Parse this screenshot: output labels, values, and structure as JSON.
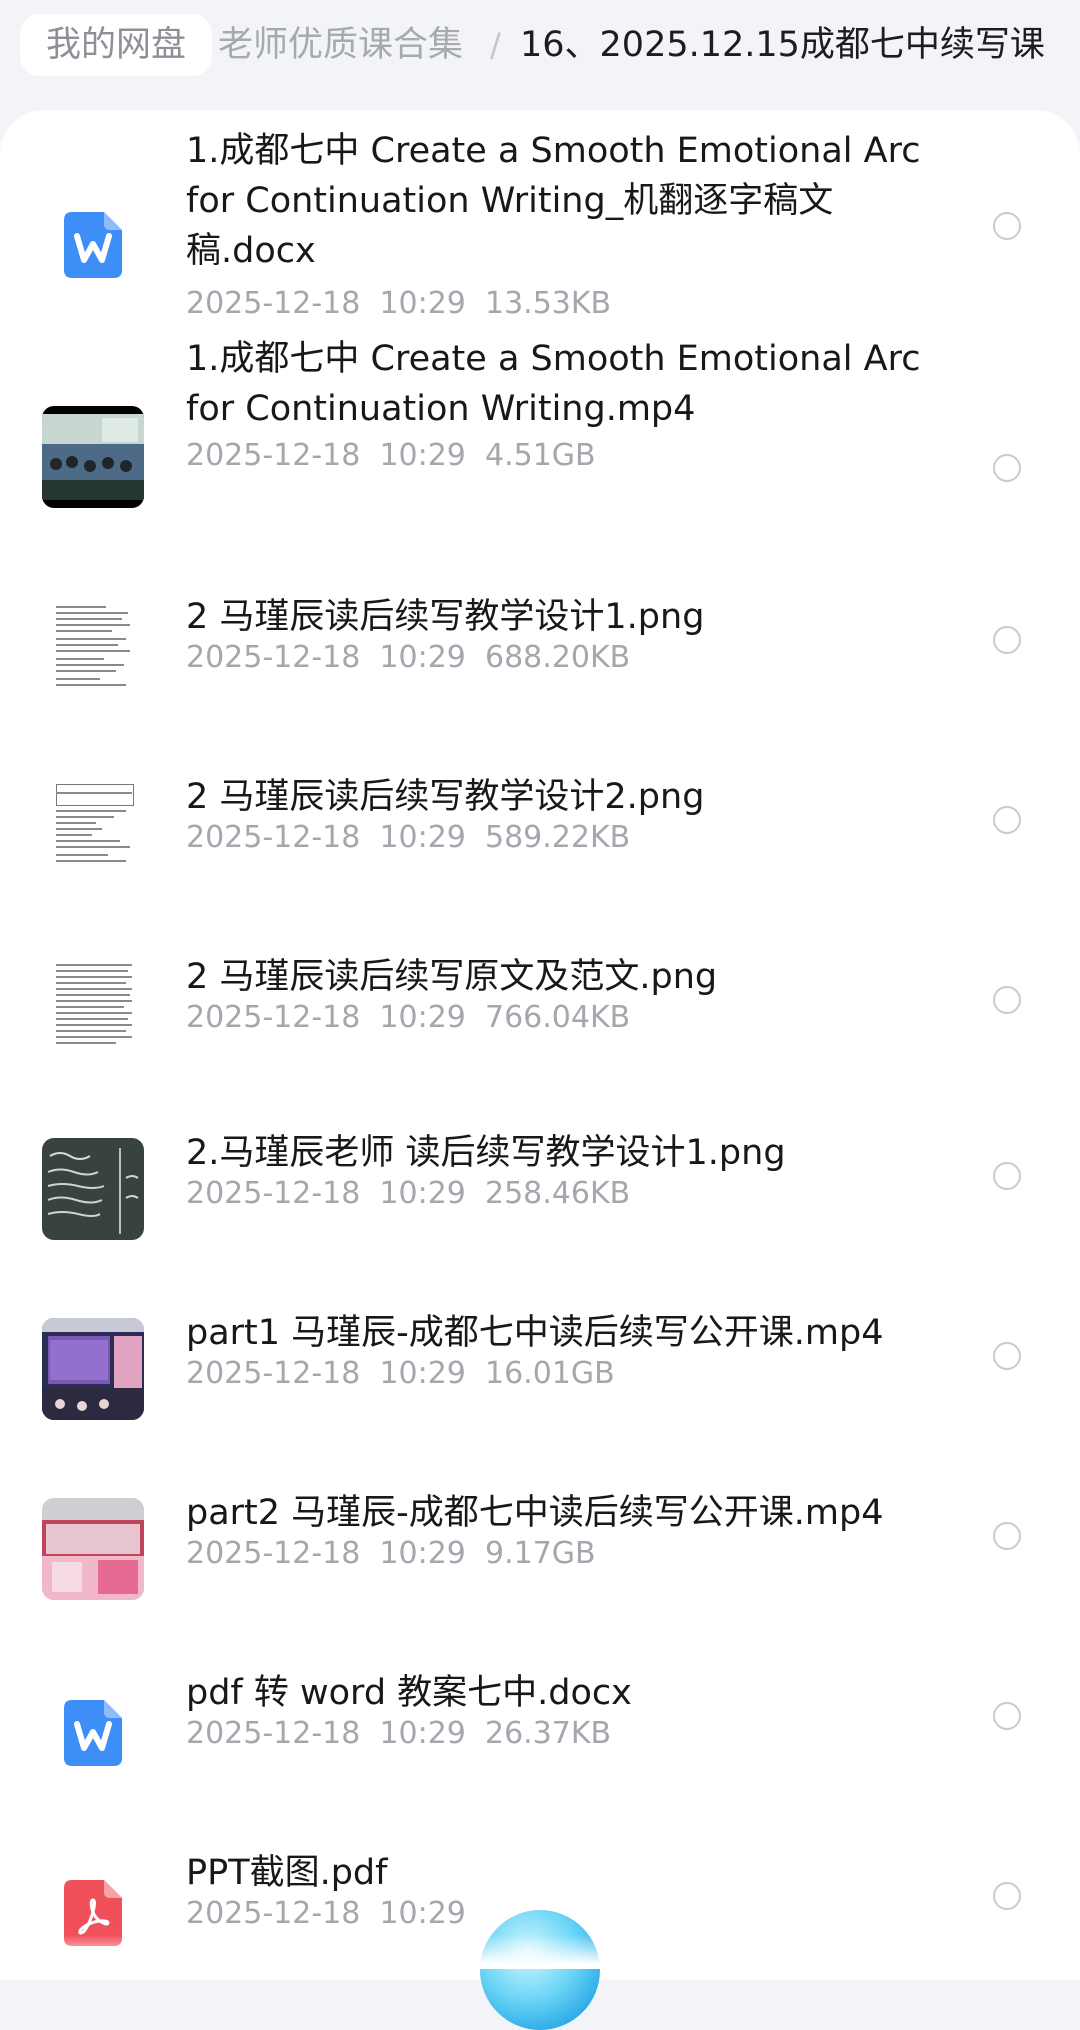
{
  "breadcrumb": {
    "home": "我的网盘",
    "parent": "老师优质课合集",
    "separator": "/",
    "current": "16、2025.12.15成都七中续写课"
  },
  "files": [
    {
      "name": "1.成都七中 Create a Smooth Emotional Arc for Continuation Writing_机翻逐字稿文稿.docx",
      "date": "2025-12-18",
      "time": "10:29",
      "size": "13.53KB",
      "icon": "word-file-icon"
    },
    {
      "name": "1.成都七中 Create a Smooth Emotional Arc for Continuation Writing.mp4",
      "date": "2025-12-18",
      "time": "10:29",
      "size": "4.51GB",
      "icon": "video-thumbnail"
    },
    {
      "name": "2 马瑾辰读后续写教学设计1.png",
      "date": "2025-12-18",
      "time": "10:29",
      "size": "688.20KB",
      "icon": "document-image-thumbnail"
    },
    {
      "name": "2 马瑾辰读后续写教学设计2.png",
      "date": "2025-12-18",
      "time": "10:29",
      "size": "589.22KB",
      "icon": "document-image-thumbnail"
    },
    {
      "name": "2 马瑾辰读后续写原文及范文.png",
      "date": "2025-12-18",
      "time": "10:29",
      "size": "766.04KB",
      "icon": "document-image-thumbnail"
    },
    {
      "name": "2.马瑾辰老师 读后续写教学设计1.png",
      "date": "2025-12-18",
      "time": "10:29",
      "size": "258.46KB",
      "icon": "blackboard-image-thumbnail"
    },
    {
      "name": "part1 马瑾辰-成都七中读后续写公开课.mp4",
      "date": "2025-12-18",
      "time": "10:29",
      "size": "16.01GB",
      "icon": "video-thumbnail"
    },
    {
      "name": "part2 马瑾辰-成都七中读后续写公开课.mp4",
      "date": "2025-12-18",
      "time": "10:29",
      "size": "9.17GB",
      "icon": "video-thumbnail"
    },
    {
      "name": "pdf 转 word 教案七中.docx",
      "date": "2025-12-18",
      "time": "10:29",
      "size": "26.37KB",
      "icon": "word-file-icon"
    },
    {
      "name": "PPT截图.pdf",
      "date": "2025-12-18",
      "time": "10:29",
      "size": "",
      "icon": "pdf-file-icon"
    }
  ],
  "colors": {
    "word": "#3d8ef7",
    "pdf": "#f0505a",
    "meta_text": "#a4a7ad"
  }
}
